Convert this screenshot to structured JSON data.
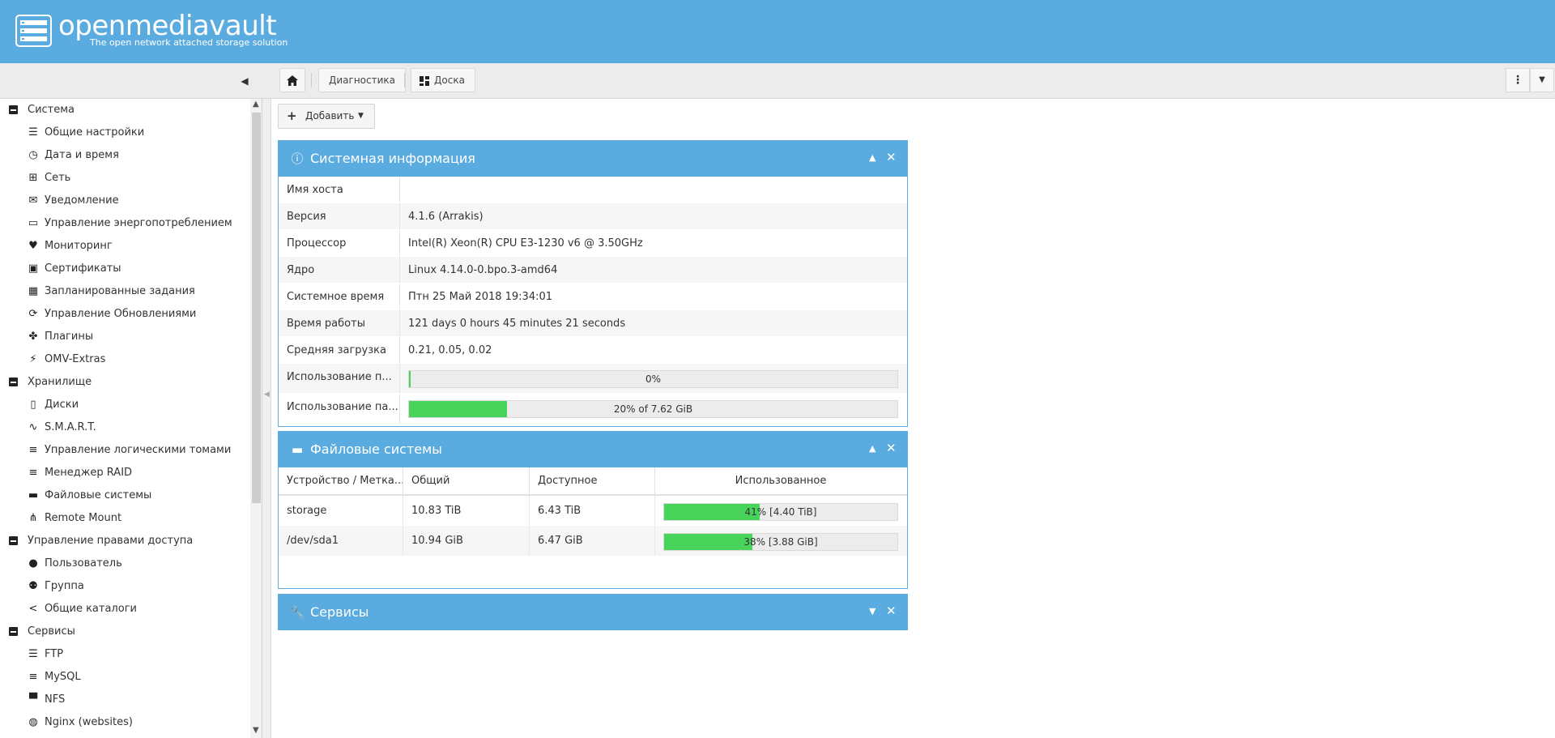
{
  "header": {
    "logo_text": "openmediavault",
    "tagline": "The open network attached storage solution"
  },
  "toolbar": {
    "collapse_icon": "caret-left-icon",
    "breadcrumb_diag": "Диагностика",
    "breadcrumb_board": "Доска",
    "menu_icon": "kebab-icon",
    "dropdown_icon": "caret-down-icon"
  },
  "sidebar": {
    "groups": [
      {
        "label": "Система",
        "items": [
          {
            "label": "Общие настройки",
            "icon": "sliders-icon"
          },
          {
            "label": "Дата и время",
            "icon": "clock-icon"
          },
          {
            "label": "Сеть",
            "icon": "network-icon"
          },
          {
            "label": "Уведомление",
            "icon": "envelope-icon"
          },
          {
            "label": "Управление энергопотреблением",
            "icon": "battery-icon"
          },
          {
            "label": "Мониторинг",
            "icon": "heartbeat-icon"
          },
          {
            "label": "Сертификаты",
            "icon": "certificate-icon"
          },
          {
            "label": "Запланированные задания",
            "icon": "calendar-clock-icon"
          },
          {
            "label": "Управление Обновлениями",
            "icon": "refresh-icon"
          },
          {
            "label": "Плагины",
            "icon": "puzzle-icon"
          },
          {
            "label": "OMV-Extras",
            "icon": "plug-icon"
          }
        ]
      },
      {
        "label": "Хранилище",
        "items": [
          {
            "label": "Диски",
            "icon": "disk-icon"
          },
          {
            "label": "S.M.A.R.T.",
            "icon": "pulse-icon"
          },
          {
            "label": "Управление логическими томами",
            "icon": "database-icon"
          },
          {
            "label": "Менеджер RAID",
            "icon": "database-icon"
          },
          {
            "label": "Файловые системы",
            "icon": "folders-icon"
          },
          {
            "label": "Remote Mount",
            "icon": "sitemap-icon"
          }
        ]
      },
      {
        "label": "Управление правами доступа",
        "items": [
          {
            "label": "Пользователь",
            "icon": "user-icon"
          },
          {
            "label": "Группа",
            "icon": "users-icon"
          },
          {
            "label": "Общие каталоги",
            "icon": "share-icon"
          }
        ]
      },
      {
        "label": "Сервисы",
        "items": [
          {
            "label": "FTP",
            "icon": "server-icon"
          },
          {
            "label": "MySQL",
            "icon": "database-icon"
          },
          {
            "label": "NFS",
            "icon": "desktop-icon"
          },
          {
            "label": "Nginx (websites)",
            "icon": "globe-icon"
          }
        ]
      }
    ]
  },
  "main": {
    "add_button": "Добавить",
    "sysinfo": {
      "title": "Системная информация",
      "rows": [
        {
          "key": "Имя хоста",
          "value": ""
        },
        {
          "key": "Версия",
          "value": "4.1.6 (Arrakis)"
        },
        {
          "key": "Процессор",
          "value": "Intel(R) Xeon(R) CPU E3-1230 v6 @ 3.50GHz"
        },
        {
          "key": "Ядро",
          "value": "Linux 4.14.0-0.bpo.3-amd64"
        },
        {
          "key": "Системное время",
          "value": "Птн 25 Май 2018 19:34:01"
        },
        {
          "key": "Время работы",
          "value": "121 days 0 hours 45 minutes 21 seconds"
        },
        {
          "key": "Средняя загрузка",
          "value": "0.21, 0.05, 0.02"
        }
      ],
      "cpu": {
        "key": "Использование п...",
        "text": "0%",
        "percent": 0
      },
      "mem": {
        "key": "Использование па...",
        "text": "20% of 7.62 GiB",
        "percent": 20
      }
    },
    "filesystems": {
      "title": "Файловые системы",
      "columns": [
        "Устройство / Метка...",
        "Общий",
        "Доступное",
        "Использованное"
      ],
      "rows": [
        {
          "device": "storage",
          "total": "10.83 TiB",
          "available": "6.43 TiB",
          "used_text": "41% [4.40 TiB]",
          "percent": 41
        },
        {
          "device": "/dev/sda1",
          "total": "10.94 GiB",
          "available": "6.47 GiB",
          "used_text": "38% [3.88 GiB]",
          "percent": 38
        }
      ]
    },
    "services": {
      "title": "Сервисы"
    }
  }
}
